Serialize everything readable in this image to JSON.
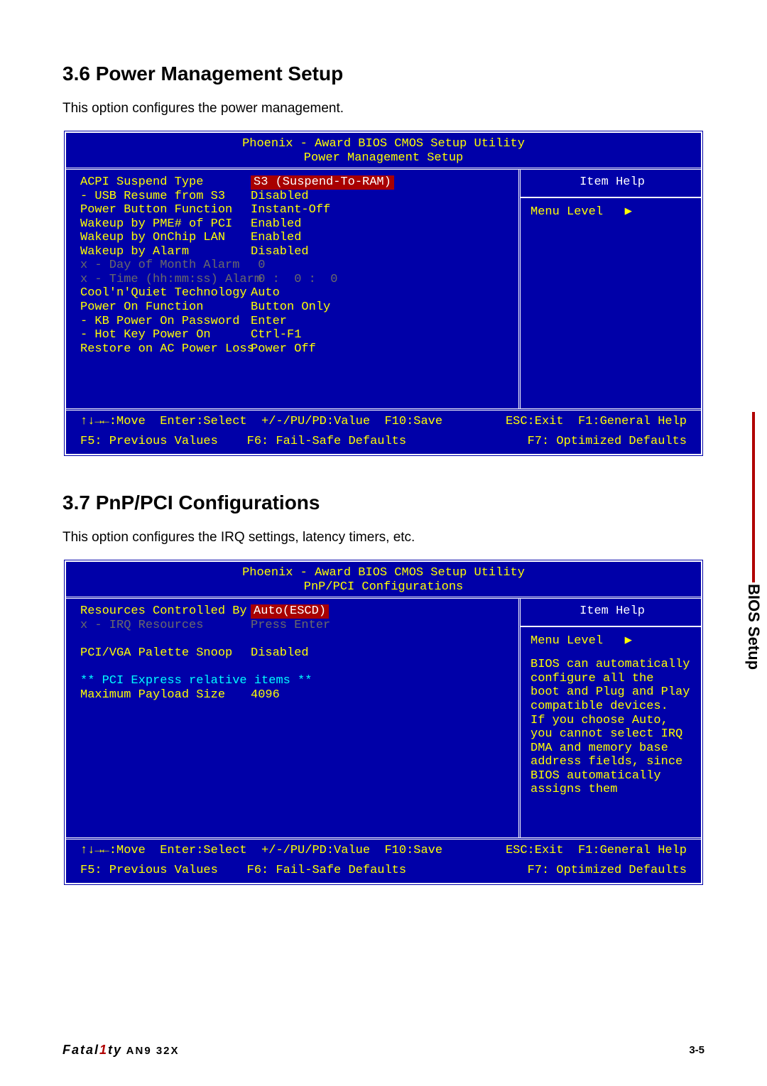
{
  "sections": {
    "s1": {
      "heading": "3.6 Power Management Setup",
      "desc": "This option configures the power management.",
      "bios_title1": "Phoenix - Award BIOS CMOS Setup Utility",
      "bios_title2": "Power Management Setup",
      "help_title": "Item Help",
      "menu_level": "Menu Level   ▶",
      "rows": [
        {
          "label": "ACPI Suspend Type",
          "val": "S3 (Suspend-To-RAM)",
          "sel": true
        },
        {
          "label": "- USB Resume from S3",
          "val": "Disabled"
        },
        {
          "label": "Power Button Function",
          "val": "Instant-Off"
        },
        {
          "label": "Wakeup by PME# of PCI",
          "val": "Enabled"
        },
        {
          "label": "Wakeup by OnChip LAN",
          "val": "Enabled"
        },
        {
          "label": "Wakeup by Alarm",
          "val": "Disabled"
        },
        {
          "label": "x - Day of Month Alarm",
          "val": " 0",
          "dim": true
        },
        {
          "label": "x - Time (hh:mm:ss) Alarm",
          "val": " 0 :  0 :  0",
          "dim": true
        },
        {
          "label": "Cool'n'Quiet Technology",
          "val": "Auto"
        },
        {
          "label": "Power On Function",
          "val": "Button Only"
        },
        {
          "label": "- KB Power On Password",
          "val": "Enter"
        },
        {
          "label": "- Hot Key Power On",
          "val": "Ctrl-F1"
        },
        {
          "label": "Restore on AC Power Loss",
          "val": "Power Off"
        }
      ],
      "footer_l1_left": "↑↓→←:Move  Enter:Select  +/-/PU/PD:Value  F10:Save",
      "footer_l1_right": "ESC:Exit  F1:General Help",
      "footer_l2_left": "F5: Previous Values    F6: Fail-Safe Defaults",
      "footer_l2_right": "F7: Optimized Defaults"
    },
    "s2": {
      "heading": "3.7 PnP/PCI Configurations",
      "desc": "This option configures the IRQ settings, latency timers, etc.",
      "bios_title1": "Phoenix - Award BIOS CMOS Setup Utility",
      "bios_title2": "PnP/PCI Configurations",
      "help_title": "Item Help",
      "menu_level": "Menu Level   ▶",
      "help_text": "BIOS can automatically\nconfigure all the\nboot and Plug and Play\ncompatible devices.\nIf you choose Auto,\nyou cannot select IRQ\nDMA and memory base\naddress fields, since\nBIOS automatically\nassigns them",
      "rows": [
        {
          "label": "Resources Controlled By",
          "val": "Auto(ESCD)",
          "sel": true
        },
        {
          "label": "x - IRQ Resources",
          "val": "Press Enter",
          "dim": true
        },
        {
          "blank": true
        },
        {
          "label": "PCI/VGA Palette Snoop",
          "val": "Disabled"
        },
        {
          "blank": true
        },
        {
          "section": "** PCI Express relative items **"
        },
        {
          "label": "Maximum Payload Size",
          "val": "4096"
        }
      ],
      "footer_l1_left": "↑↓→←:Move  Enter:Select  +/-/PU/PD:Value  F10:Save",
      "footer_l1_right": "ESC:Exit  F1:General Help",
      "footer_l2_left": "F5: Previous Values    F6: Fail-Safe Defaults",
      "footer_l2_right": "F7: Optimized Defaults"
    }
  },
  "side_tab": "BIOS Setup",
  "product": "Fatal1ty AN9 32X",
  "page_num": "3-5"
}
